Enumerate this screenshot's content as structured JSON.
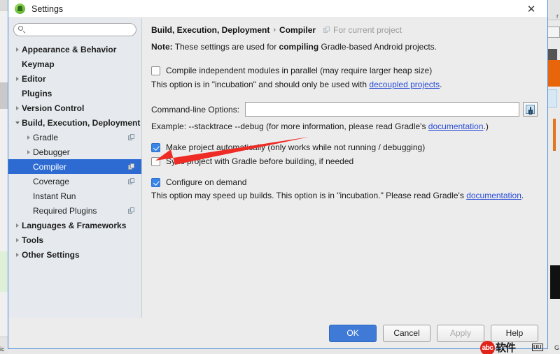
{
  "window": {
    "title": "Settings",
    "app_icon": "android-studio-icon",
    "close_label": "✕"
  },
  "sidebar": {
    "search": {
      "value": "",
      "placeholder": "",
      "icon": "search-icon"
    },
    "items": [
      {
        "label": "Appearance & Behavior",
        "indent": 0,
        "twisty": "right",
        "bold": true,
        "selected": false,
        "badge": false
      },
      {
        "label": "Keymap",
        "indent": 0,
        "twisty": "none",
        "bold": true,
        "selected": false,
        "badge": false
      },
      {
        "label": "Editor",
        "indent": 0,
        "twisty": "right",
        "bold": true,
        "selected": false,
        "badge": false
      },
      {
        "label": "Plugins",
        "indent": 0,
        "twisty": "none",
        "bold": true,
        "selected": false,
        "badge": false
      },
      {
        "label": "Version Control",
        "indent": 0,
        "twisty": "right",
        "bold": true,
        "selected": false,
        "badge": false
      },
      {
        "label": "Build, Execution, Deployment",
        "indent": 0,
        "twisty": "down",
        "bold": true,
        "selected": false,
        "badge": false
      },
      {
        "label": "Gradle",
        "indent": 1,
        "twisty": "right",
        "bold": false,
        "selected": false,
        "badge": true
      },
      {
        "label": "Debugger",
        "indent": 1,
        "twisty": "right",
        "bold": false,
        "selected": false,
        "badge": false
      },
      {
        "label": "Compiler",
        "indent": 1,
        "twisty": "none",
        "bold": false,
        "selected": true,
        "badge": true
      },
      {
        "label": "Coverage",
        "indent": 1,
        "twisty": "none",
        "bold": false,
        "selected": false,
        "badge": true
      },
      {
        "label": "Instant Run",
        "indent": 1,
        "twisty": "none",
        "bold": false,
        "selected": false,
        "badge": false
      },
      {
        "label": "Required Plugins",
        "indent": 1,
        "twisty": "none",
        "bold": false,
        "selected": false,
        "badge": true
      },
      {
        "label": "Languages & Frameworks",
        "indent": 0,
        "twisty": "right",
        "bold": true,
        "selected": false,
        "badge": false
      },
      {
        "label": "Tools",
        "indent": 0,
        "twisty": "right",
        "bold": true,
        "selected": false,
        "badge": false
      },
      {
        "label": "Other Settings",
        "indent": 0,
        "twisty": "right",
        "bold": true,
        "selected": false,
        "badge": false
      }
    ]
  },
  "main": {
    "breadcrumb": {
      "root": "Build, Execution, Deployment",
      "separator": "›",
      "leaf": "Compiler",
      "scope": "For current project",
      "scope_icon": "project-scope-icon"
    },
    "note": {
      "prefix": "Note:",
      "part1": " These settings are used for ",
      "emphasis": "compiling",
      "part2": " Gradle-based Android projects."
    },
    "compile_parallel": {
      "checked": false,
      "label": "Compile independent modules in parallel (may require larger heap size)",
      "hint_before": "This option is in \"incubation\" and should only be used with ",
      "hint_link": "decoupled projects",
      "hint_after": "."
    },
    "command_line": {
      "label": "Command-line Options:",
      "value": "",
      "placeholder": "",
      "expand_button_icon": "expand-input-icon",
      "example_before": "Example: --stacktrace --debug (for more information, please read Gradle's ",
      "example_link": "documentation",
      "example_after": ".)"
    },
    "make_automatically": {
      "checked": true,
      "label": "Make project automatically (only works while not running / debugging)"
    },
    "sync_before_build": {
      "checked": false,
      "label": "Sync project with Gradle before building, if needed"
    },
    "configure_on_demand": {
      "checked": true,
      "label": "Configure on demand",
      "hint_before": "This option may speed up builds. This option is in \"incubation.\" Please read Gradle's ",
      "hint_link": "documentation",
      "hint_after": "."
    }
  },
  "footer": {
    "ok": "OK",
    "cancel": "Cancel",
    "apply": "Apply",
    "apply_disabled": true,
    "help": "Help"
  },
  "annotation": {
    "arrow_color": "#ee2b24",
    "target": "make-project-automatically-checkbox"
  },
  "watermark": {
    "badge": "abc",
    "text": "软件",
    "sub": "UU"
  },
  "background": {
    "left_label": "ic",
    "right_label": "G",
    "accent_orange": "#e8660b",
    "accent_blue": "#4a90d9"
  }
}
